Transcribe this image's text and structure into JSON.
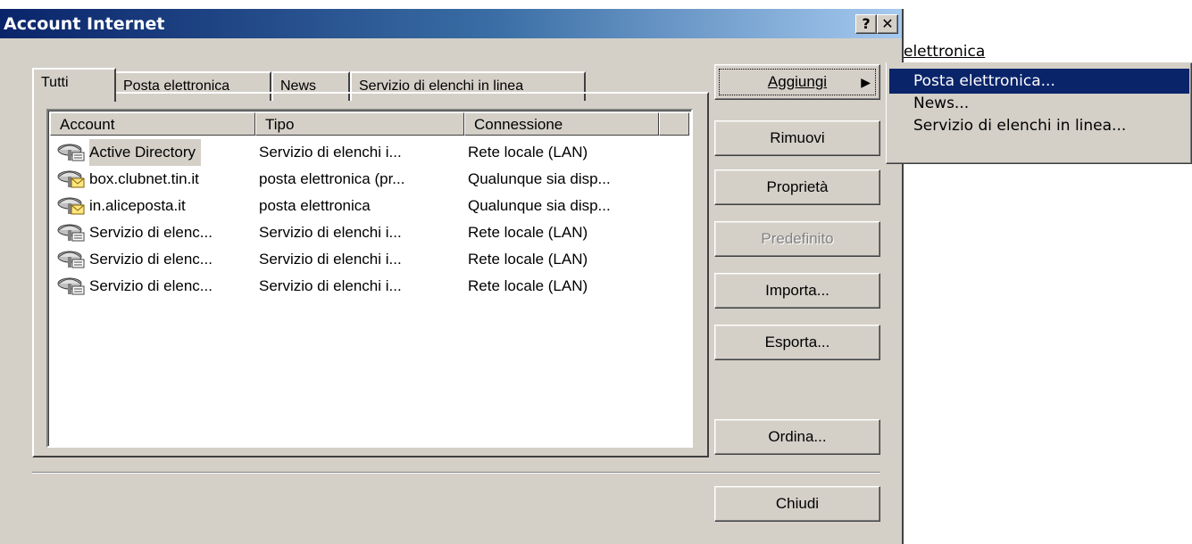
{
  "background": {
    "link_text": "elettronica"
  },
  "window": {
    "title": "Account Internet",
    "help_btn": "?",
    "close_btn": "✕"
  },
  "tabs": [
    "Tutti",
    "Posta elettronica",
    "News",
    "Servizio di elenchi in linea"
  ],
  "list": {
    "columns": [
      "Account",
      "Tipo",
      "Connessione"
    ],
    "rows": [
      {
        "account": "Active Directory",
        "tipo": "Servizio di elenchi i...",
        "connessione": "Rete locale (LAN)",
        "icon": "directory-service-icon"
      },
      {
        "account": "box.clubnet.tin.it",
        "tipo": "posta elettronica (pr...",
        "connessione": "Qualunque sia disp...",
        "icon": "mail-account-icon"
      },
      {
        "account": "in.aliceposta.it",
        "tipo": "posta elettronica",
        "connessione": "Qualunque sia disp...",
        "icon": "mail-account-icon"
      },
      {
        "account": "Servizio di elenc...",
        "tipo": "Servizio di elenchi i...",
        "connessione": "Rete locale (LAN)",
        "icon": "directory-service-icon"
      },
      {
        "account": "Servizio di elenc...",
        "tipo": "Servizio di elenchi i...",
        "connessione": "Rete locale (LAN)",
        "icon": "directory-service-icon"
      },
      {
        "account": "Servizio di elenc...",
        "tipo": "Servizio di elenchi i...",
        "connessione": "Rete locale (LAN)",
        "icon": "directory-service-icon"
      }
    ]
  },
  "buttons": {
    "aggiungi": "Aggiungi",
    "rimuovi": "Rimuovi",
    "proprieta": "Proprietà",
    "predefinito": "Predefinito",
    "importa": "Importa...",
    "esporta": "Esporta...",
    "ordina": "Ordina...",
    "chiudi": "Chiudi"
  },
  "menu": {
    "items": [
      "Posta elettronica...",
      "News...",
      "Servizio di elenchi in linea..."
    ]
  },
  "colors": {
    "titlebar": "#0a246a",
    "face": "#d4d0c8",
    "highlight": "#0a246a"
  }
}
